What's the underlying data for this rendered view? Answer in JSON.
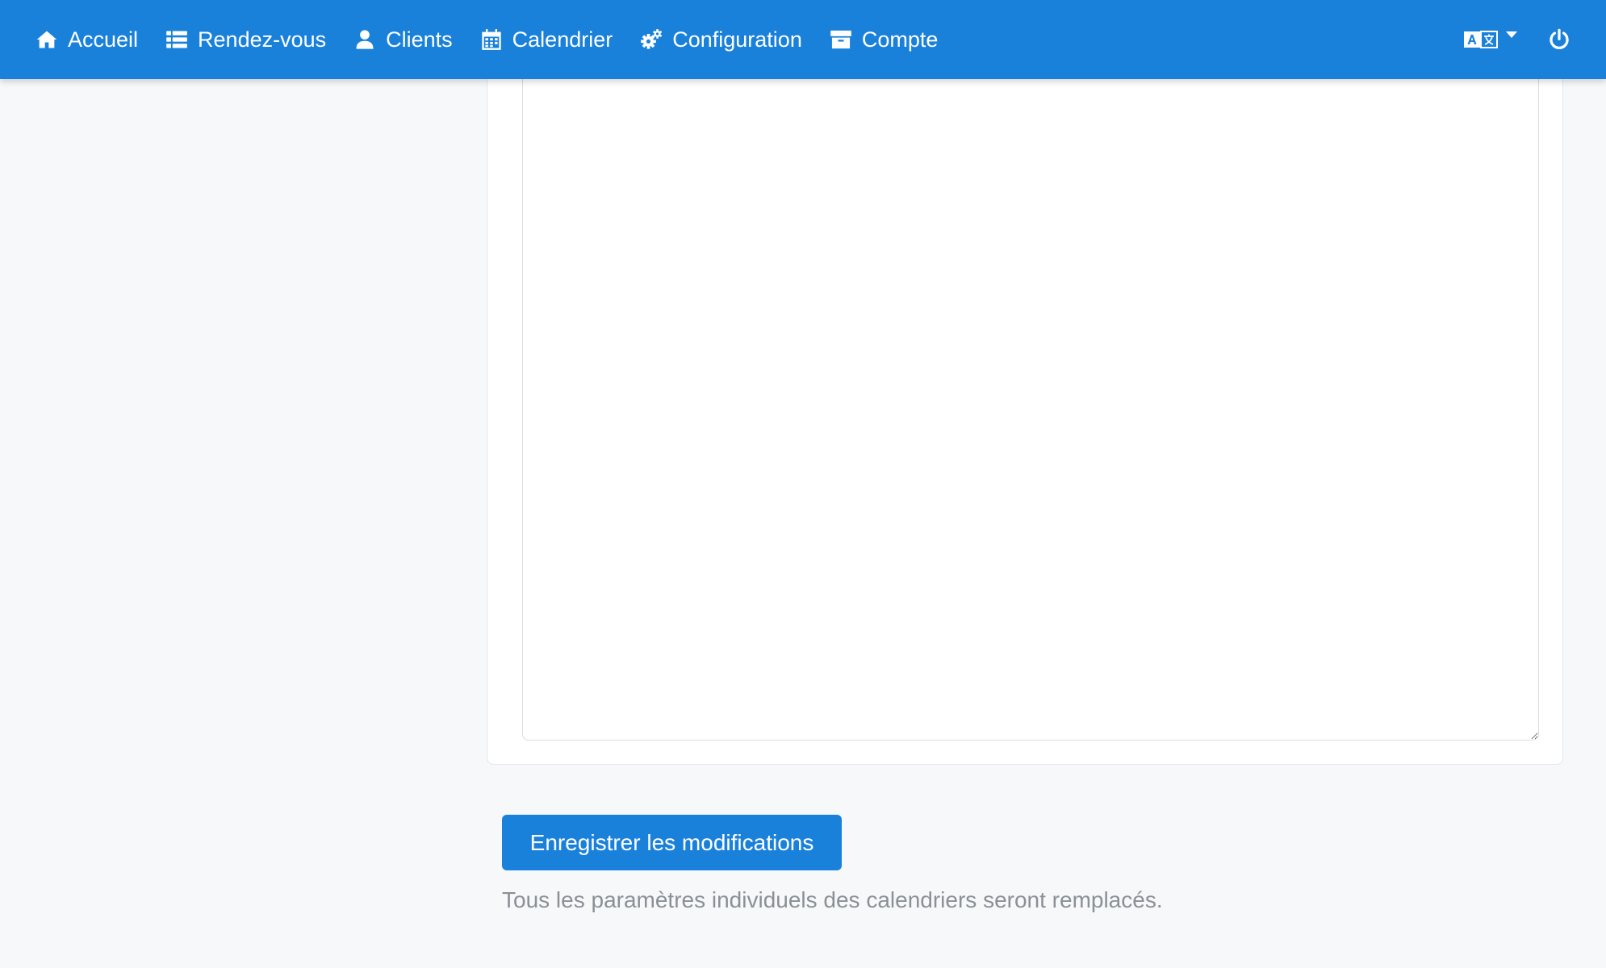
{
  "navbar": {
    "background": "#1a81db",
    "items": [
      {
        "label": "Accueil",
        "icon": "home-icon"
      },
      {
        "label": "Rendez-vous",
        "icon": "list-icon"
      },
      {
        "label": "Clients",
        "icon": "user-icon"
      },
      {
        "label": "Calendrier",
        "icon": "calendar-icon"
      },
      {
        "label": "Configuration",
        "icon": "cogs-icon"
      },
      {
        "label": "Compte",
        "icon": "archive-icon"
      }
    ],
    "right": {
      "language_icon": "language-icon",
      "power_icon": "power-icon"
    }
  },
  "editor": {
    "value": ""
  },
  "actions": {
    "save_label": "Enregistrer les modifications",
    "accent": "#1a81db"
  },
  "help": {
    "text": "Tous les paramètres individuels des calendriers seront remplacés."
  }
}
